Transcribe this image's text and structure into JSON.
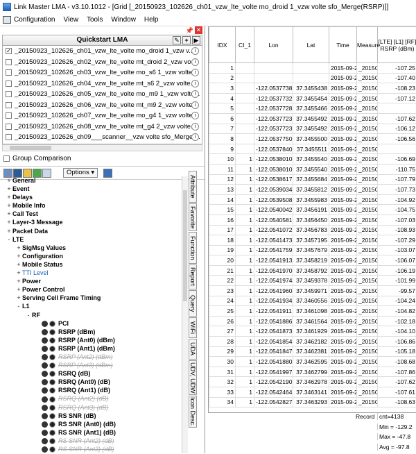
{
  "window": {
    "title": "Link Master LMA  -  v3.10.1012  -  [Grid [_20150923_102626_ch01_vzw_lte_volte mo_droid 1_vzw volte sfo_Merge(RSRP)]]"
  },
  "menu": [
    "Configuration",
    "View",
    "Tools",
    "Window",
    "Help"
  ],
  "quickstart": {
    "title": "Quickstart LMA",
    "items": [
      {
        "label": "_20150923_102626_ch01_vzw_lte_volte mo_droid 1_vzw v...",
        "checked": true
      },
      {
        "label": "_20150923_102626_ch02_vzw_lte_volte mt_droid 2_vzw vo...",
        "checked": false
      },
      {
        "label": "_20150923_102626_ch03_vzw_lte_volte mo_s6 1_vzw volte...",
        "checked": false
      },
      {
        "label": "_20150923_102626_ch04_vzw_lte_volte mt_s6 2_vzw volte...",
        "checked": false
      },
      {
        "label": "_20150923_102626_ch05_vzw_lte_volte mo_m9 1_vzw volte...",
        "checked": false
      },
      {
        "label": "_20150923_102626_ch06_vzw_lte_volte mt_m9 2_vzw volte...",
        "checked": false
      },
      {
        "label": "_20150923_102626_ch07_vzw_lte_volte mo_g4 1_vzw volte...",
        "checked": false
      },
      {
        "label": "_20150923_102626_ch08_vzw_lte_volte mt_g4 2_vzw volte...",
        "checked": false
      },
      {
        "label": "_20150923_102626_ch09___scanner__vzw volte sfo_Merge ...",
        "checked": false
      }
    ]
  },
  "group_comparison": "Group Comparison",
  "options_label": "Options",
  "tree": [
    {
      "label": "General",
      "indent": 0,
      "exp": "+",
      "style": "bold"
    },
    {
      "label": "Event",
      "indent": 0,
      "exp": "+",
      "style": "bold"
    },
    {
      "label": "Delays",
      "indent": 0,
      "exp": "+",
      "style": "bold"
    },
    {
      "label": "Mobile Info",
      "indent": 0,
      "exp": "+",
      "style": "bold"
    },
    {
      "label": "Call Test",
      "indent": 0,
      "exp": "+",
      "style": "bold"
    },
    {
      "label": "Layer-3 Message",
      "indent": 0,
      "exp": "+",
      "style": "bold"
    },
    {
      "label": "Packet Data",
      "indent": 0,
      "exp": "+",
      "style": "bold"
    },
    {
      "label": "LTE",
      "indent": 0,
      "exp": "-",
      "style": "bold"
    },
    {
      "label": "SigMsg Values",
      "indent": 1,
      "exp": "+",
      "style": "bold"
    },
    {
      "label": "Configuration",
      "indent": 1,
      "exp": "+",
      "style": "bold"
    },
    {
      "label": "Mobile Status",
      "indent": 1,
      "exp": "+",
      "style": "bold"
    },
    {
      "label": "TTI Level",
      "indent": 1,
      "exp": "+",
      "style": "link"
    },
    {
      "label": "Power",
      "indent": 1,
      "exp": "+",
      "style": "bold"
    },
    {
      "label": "Power Control",
      "indent": 1,
      "exp": "+",
      "style": "bold"
    },
    {
      "label": "Serving Cell Frame Timing",
      "indent": 1,
      "exp": "+",
      "style": "bold"
    },
    {
      "label": "L1",
      "indent": 1,
      "exp": "-",
      "style": "bold"
    },
    {
      "label": "RF",
      "indent": 2,
      "exp": "-",
      "style": "bold"
    },
    {
      "label": "PCI",
      "indent": 3,
      "exp": "",
      "style": "bold",
      "icon": true
    },
    {
      "label": "RSRP (dBm)",
      "indent": 3,
      "exp": "",
      "style": "bold",
      "icon": true
    },
    {
      "label": "RSRP (Ant0) (dBm)",
      "indent": 3,
      "exp": "",
      "style": "bold",
      "icon": true
    },
    {
      "label": "RSRP (Ant1) (dBm)",
      "indent": 3,
      "exp": "",
      "style": "bold",
      "icon": true
    },
    {
      "label": "RSRP (Ant2) (dBm)",
      "indent": 3,
      "exp": "",
      "style": "grey",
      "icon": true
    },
    {
      "label": "RSRP (Ant3) (dBm)",
      "indent": 3,
      "exp": "",
      "style": "grey",
      "icon": true
    },
    {
      "label": "RSRQ (dB)",
      "indent": 3,
      "exp": "",
      "style": "bold",
      "icon": true
    },
    {
      "label": "RSRQ (Ant0) (dB)",
      "indent": 3,
      "exp": "",
      "style": "bold",
      "icon": true
    },
    {
      "label": "RSRQ (Ant1) (dB)",
      "indent": 3,
      "exp": "",
      "style": "bold",
      "icon": true
    },
    {
      "label": "RSRQ (Ant2) (dB)",
      "indent": 3,
      "exp": "",
      "style": "grey",
      "icon": true
    },
    {
      "label": "RSRQ (Ant3) (dB)",
      "indent": 3,
      "exp": "",
      "style": "grey",
      "icon": true
    },
    {
      "label": "RS SNR (dB)",
      "indent": 3,
      "exp": "",
      "style": "bold",
      "icon": true
    },
    {
      "label": "RS SNR (Ant0) (dB)",
      "indent": 3,
      "exp": "",
      "style": "bold",
      "icon": true
    },
    {
      "label": "RS SNR (Ant1) (dB)",
      "indent": 3,
      "exp": "",
      "style": "bold",
      "icon": true
    },
    {
      "label": "RS SNR (Ant2) (dB)",
      "indent": 3,
      "exp": "",
      "style": "grey",
      "icon": true
    },
    {
      "label": "RS SNR (Ant3) (dB)",
      "indent": 3,
      "exp": "",
      "style": "grey",
      "icon": true
    }
  ],
  "side_tabs": [
    "Attribute",
    "Favorite",
    "Function",
    "Report",
    "Query",
    "WiFi",
    "UDA",
    "UDV, UDW",
    "Icon Desc."
  ],
  "grid": {
    "headers": [
      "IDX",
      "CI_1",
      "Lon",
      "Lat",
      "Time",
      "Measure",
      "[LTE] [L1] [RF] RSRP (dBm)"
    ],
    "rows": [
      [
        "1",
        "",
        "",
        "",
        "2015-09-2",
        "_2015C",
        "-107.25"
      ],
      [
        "2",
        "",
        "",
        "",
        "2015-09-2",
        "_2015C",
        "-107.40"
      ],
      [
        "3",
        "",
        "-122.0537738",
        "37.3455438",
        "2015-09-2",
        "_2015C",
        "-108.23"
      ],
      [
        "4",
        "",
        "-122.0537732",
        "37.3455454",
        "2015-09-2",
        "_2015C",
        "-107.12"
      ],
      [
        "5",
        "",
        "-122.0537728",
        "37.3455466",
        "2015-09-2",
        "_2015C",
        ""
      ],
      [
        "6",
        "",
        "-122.0537723",
        "37.3455492",
        "2015-09-2",
        "_2015C",
        "-107.62"
      ],
      [
        "7",
        "",
        "-122.0537723",
        "37.3455492",
        "2015-09-2",
        "_2015C",
        "-106.12"
      ],
      [
        "8",
        "",
        "-122.0537750",
        "37.3455500",
        "2015-09-2",
        "_2015C",
        "-106.56"
      ],
      [
        "9",
        "",
        "-122.0537840",
        "37.3455511",
        "2015-09-2",
        "_2015C",
        ""
      ],
      [
        "10",
        "1",
        "-122.0538010",
        "37.3455540",
        "2015-09-2",
        "_2015C",
        "-106.69"
      ],
      [
        "11",
        "1",
        "-122.0538010",
        "37.3455540",
        "2015-09-2",
        "_2015C",
        "-110.75"
      ],
      [
        "12",
        "1",
        "-122.0538617",
        "37.3455684",
        "2015-09-2",
        "_2015C",
        "-107.79"
      ],
      [
        "13",
        "1",
        "-122.0539034",
        "37.3455812",
        "2015-09-2",
        "_2015C",
        "-107.73"
      ],
      [
        "14",
        "1",
        "-122.0539508",
        "37.3455983",
        "2015-09-2",
        "_2015C",
        "-104.92"
      ],
      [
        "15",
        "1",
        "-122.0540042",
        "37.3456191",
        "2015-09-2",
        "_2015C",
        "-104.75"
      ],
      [
        "16",
        "1",
        "-122.0540581",
        "37.3456450",
        "2015-09-2",
        "_2015C",
        "-107.03"
      ],
      [
        "17",
        "1",
        "-122.0541072",
        "37.3456783",
        "2015-09-2",
        "_2015C",
        "-108.93"
      ],
      [
        "18",
        "1",
        "-122.0541473",
        "37.3457195",
        "2015-09-2",
        "_2015C",
        "-107.29"
      ],
      [
        "19",
        "1",
        "-122.0541759",
        "37.3457679",
        "2015-09-2",
        "_2015C",
        "-103.07"
      ],
      [
        "20",
        "1",
        "-122.0541913",
        "37.3458219",
        "2015-09-2",
        "_2015C",
        "-106.07"
      ],
      [
        "21",
        "1",
        "-122.0541970",
        "37.3458792",
        "2015-09-2",
        "_2015C",
        "-106.19"
      ],
      [
        "22",
        "1",
        "-122.0541974",
        "37.3459378",
        "2015-09-2",
        "_2015C",
        "-101.99"
      ],
      [
        "23",
        "1",
        "-122.0541960",
        "37.3459971",
        "2015-09-2",
        "_2015C",
        "-99.57"
      ],
      [
        "24",
        "1",
        "-122.0541934",
        "37.3460556",
        "2015-09-2",
        "_2015C",
        "-104.24"
      ],
      [
        "25",
        "1",
        "-122.0541911",
        "37.3461098",
        "2015-09-2",
        "_2015C",
        "-104.82"
      ],
      [
        "26",
        "1",
        "-122.0541886",
        "37.3461564",
        "2015-09-2",
        "_2015C",
        "-102.18"
      ],
      [
        "27",
        "1",
        "-122.0541873",
        "37.3461929",
        "2015-09-2",
        "_2015C",
        "-104.10"
      ],
      [
        "28",
        "1",
        "-122.0541854",
        "37.3462182",
        "2015-09-2",
        "_2015C",
        "-106.86"
      ],
      [
        "29",
        "1",
        "-122.0541847",
        "37.3462381",
        "2015-09-2",
        "_2015C",
        "-105.18"
      ],
      [
        "30",
        "1",
        "-122.0541880",
        "37.3462595",
        "2015-09-2",
        "_2015C",
        "-108.68"
      ],
      [
        "31",
        "1",
        "-122.0541997",
        "37.3462799",
        "2015-09-2",
        "_2015C",
        "-107.86"
      ],
      [
        "32",
        "1",
        "-122.0542190",
        "37.3462978",
        "2015-09-2",
        "_2015C",
        "-107.62"
      ],
      [
        "33",
        "1",
        "-122.0542464",
        "37.3463141",
        "2015-09-2",
        "_2015C",
        "-107.61"
      ],
      [
        "34",
        "1",
        "-122.0542827",
        "37.3463293",
        "2015-09-2",
        "_2015C",
        "-108.63"
      ]
    ]
  },
  "footer": {
    "record_label": "Record",
    "cnt": "cnt=4138",
    "min": "Min = -129.2",
    "max": "Max = -47.8",
    "avg": "Avg = -97.8"
  }
}
